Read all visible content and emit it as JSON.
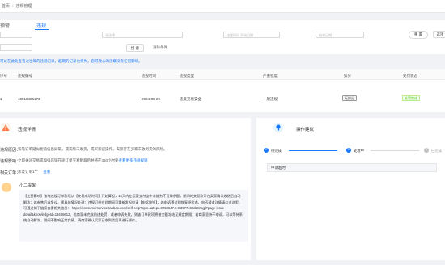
{
  "breadcrumb": {
    "parent": "首页",
    "current": "违规管理"
  },
  "subtabs": [
    {
      "label": "预警"
    },
    {
      "label": "违规"
    }
  ],
  "filter": {
    "select_placeholder": "请选择",
    "time_start_placeholder": "违规时间 开始日期",
    "time_end_placeholder": "结束日期",
    "reset_label": "重 置",
    "search_label": "搜 索",
    "clear_label": "清除条件",
    "more_label": "选项"
  },
  "notice": "可以在此处查看过往年的违规记录，超期的记录也将失，您可放心的涉嫌没有任何影响。",
  "table": {
    "headers": [
      "序号",
      "违规编号",
      "违规时间",
      "违规类型",
      "严重程度",
      "扣分",
      "处罚状态"
    ],
    "row": {
      "index": "1",
      "id": "48518485173",
      "date": "2024-09-29",
      "type": "违反交易安全",
      "severity": "一般违规",
      "points": "无扣分",
      "status": "处罚完成"
    }
  },
  "detail": {
    "title": "违规详情",
    "reason_label": "违规原因：",
    "reason_value": "该笔订单疑似物流信息异常，或实际未发货，或买家误操作，实际存在买家未收到货的风险。",
    "impact_label": "违规影响：",
    "impact_value": "立即关闭交易或加强店铺在途订单交易制裁后并将在360小时处",
    "impact_link": "查看更多违规规则",
    "order_label": "相关订单：",
    "order_value": "涉及订单1个",
    "order_link": "查看"
  },
  "message": {
    "sender": "小二提醒",
    "text": "【处罚影响】该笔违规订单款项从【交易成功时间】开始算起，15天内在买家支付宝中未能为不可用余额，期间的交易款可在买家确认收货后自动解冻；若有售后或争议，视具体情况处理；违规订单在此期间可重新发起申请【申诉按钮】，若申诉通过则恢复原状态。申诉通道详情请点击这里，可通过如下链接查看相关信息： https://consumerservice.taobao.com/self-help?spm=a21pu.8253647.0.0.3577480d2Wpgjl#page-issue-detail&knowledgeId=13486612。若商家未完成前述处罚，或者申诉失败，则该订单款项将被全额冻结至规定期限；若商家坚持不申诉，可以等待系统自动解冻，期间不影响正常交易，请商家确认买家已收到货后再进行操作。"
  },
  "progress": {
    "title": "操作建议",
    "steps": [
      {
        "label": "待完成",
        "num": "1",
        "color": "#1677ff"
      },
      {
        "label": "处理中",
        "num": "2",
        "color": "#1677ff"
      },
      {
        "label": "已完成",
        "num": "3",
        "color": "#bfbfbf"
      }
    ],
    "status": "申诉超时"
  },
  "colors": {
    "accent": "#1677ff",
    "success": "#52c41a",
    "warning": "#ff7a45",
    "bulb": "#1677ff"
  }
}
